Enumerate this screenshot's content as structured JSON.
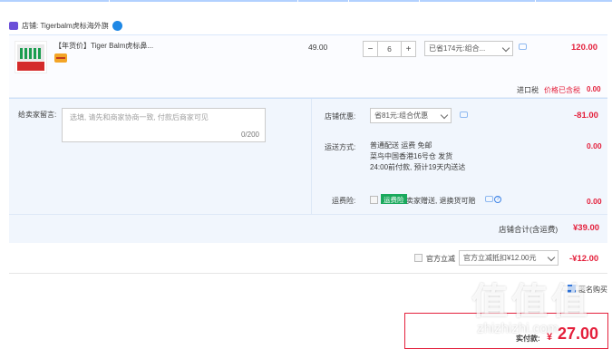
{
  "shop": {
    "label": "店铺: Tigerbalm虎标海外旗"
  },
  "item": {
    "name": "【年货价】Tiger Balm虎标鼻...",
    "unit_price": "49.00",
    "quantity": "6",
    "promo_select": "已省174元:组合...",
    "subtotal": "120.00",
    "tax_label": "进口税",
    "tax_note": "价格已含税",
    "tax_value": "0.00"
  },
  "note": {
    "label": "给卖家留言:",
    "placeholder": "选填, 请先和商家协商一致, 付款后商家可见",
    "count": "0/200"
  },
  "discount": {
    "label": "店铺优惠:",
    "select": "省81元:组合优惠",
    "value": "-81.00"
  },
  "shipping": {
    "label": "运送方式:",
    "line1": "普通配送 运费 免邮",
    "line2": "菜鸟中国香港16号仓 发货",
    "line3": "24:00前付款, 预计19天内送达",
    "value": "0.00"
  },
  "insurance": {
    "label": "运费险:",
    "badge": "运费险",
    "text": "卖家赠送, 退换货可赔",
    "help": "?",
    "value": "0.00"
  },
  "shop_total": {
    "label": "店铺合计(含运费)",
    "value": "¥39.00"
  },
  "official": {
    "label": "官方立减",
    "select": "官方立减抵扣¥12.00元",
    "value": "-¥12.00"
  },
  "anon": {
    "label": "匿名购买"
  },
  "pay": {
    "label": "实付款:",
    "currency": "¥",
    "value": "27.00"
  },
  "watermark": {
    "big": "值值值",
    "site": "zhizhizhi.com"
  },
  "colors": {
    "accent_red": "#e4203c",
    "brand_blue": "#2c77e6",
    "panel_bg": "#f1f6fd"
  }
}
